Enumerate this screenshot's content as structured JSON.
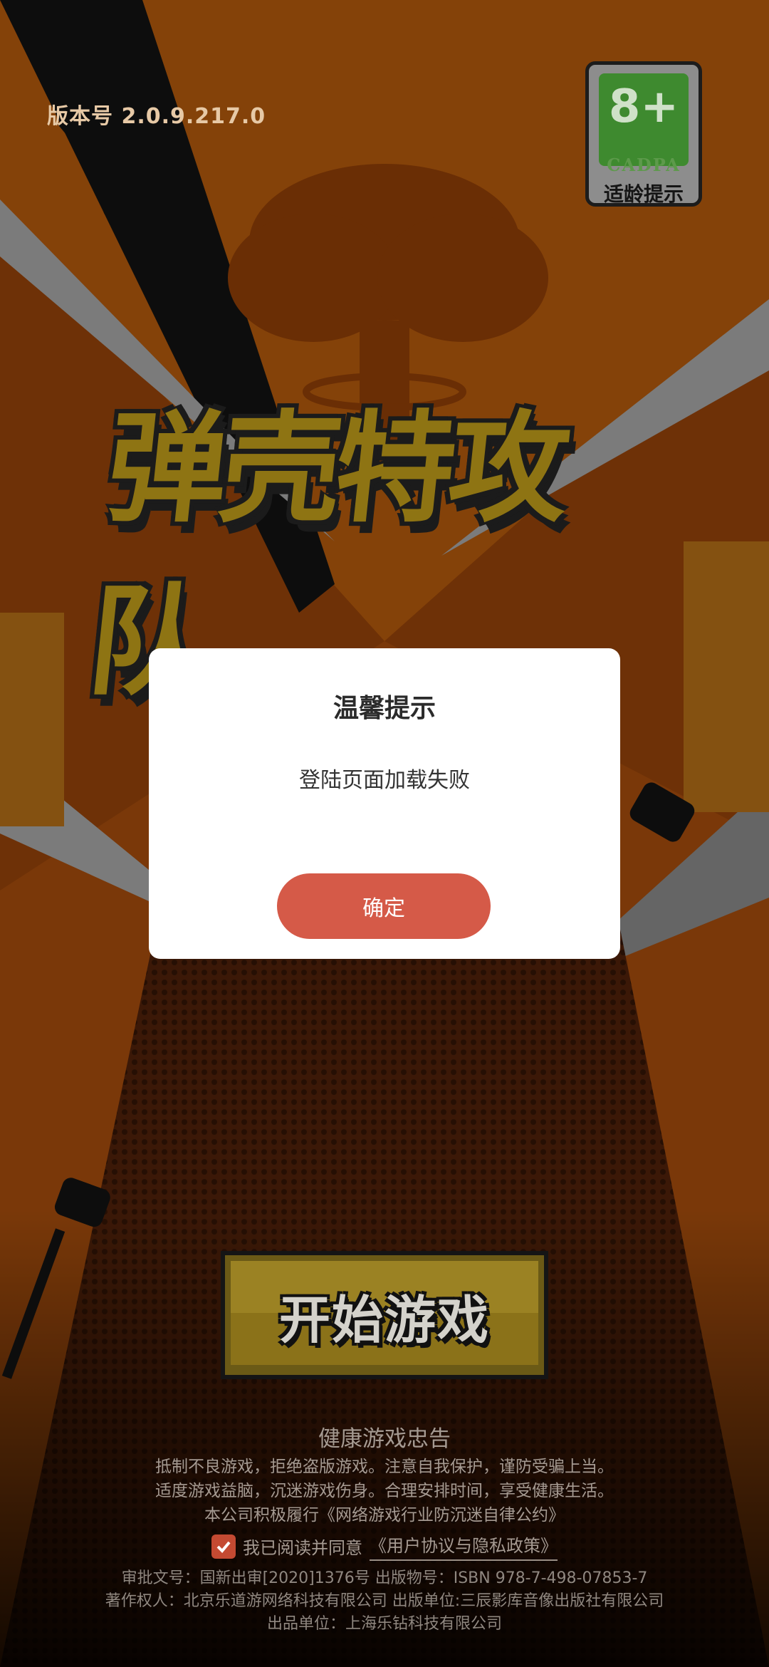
{
  "app": {
    "version_text": "版本号 2.0.9.217.0",
    "game_title": "弹壳特攻队"
  },
  "age_rating": {
    "value": "8+",
    "org": "CADPA",
    "label": "适龄提示"
  },
  "dialog": {
    "title": "温馨提示",
    "message": "登陆页面加载失败",
    "confirm_label": "确定"
  },
  "start_button": {
    "label": "开始游戏"
  },
  "advisory": {
    "title": "健康游戏忠告",
    "lines": [
      "抵制不良游戏，拒绝盗版游戏。注意自我保护，谨防受骗上当。",
      "适度游戏益脑，沉迷游戏伤身。合理安排时间，享受健康生活。",
      "本公司积极履行《网络游戏行业防沉迷自律公约》"
    ]
  },
  "agreement": {
    "checked": true,
    "text": "我已阅读并同意",
    "link": "《用户协议与隐私政策》"
  },
  "legal": [
    "审批文号：国新出审[2020]1376号 出版物号：ISBN 978-7-498-07853-7",
    "著作权人：北京乐道游网络科技有限公司 出版单位:三辰影库音像出版社有限公司",
    "出品单位：上海乐钻科技有限公司"
  ],
  "colors": {
    "accent": "#d55a48",
    "background": "#b9560e",
    "badge_green": "#3e8a2f"
  }
}
